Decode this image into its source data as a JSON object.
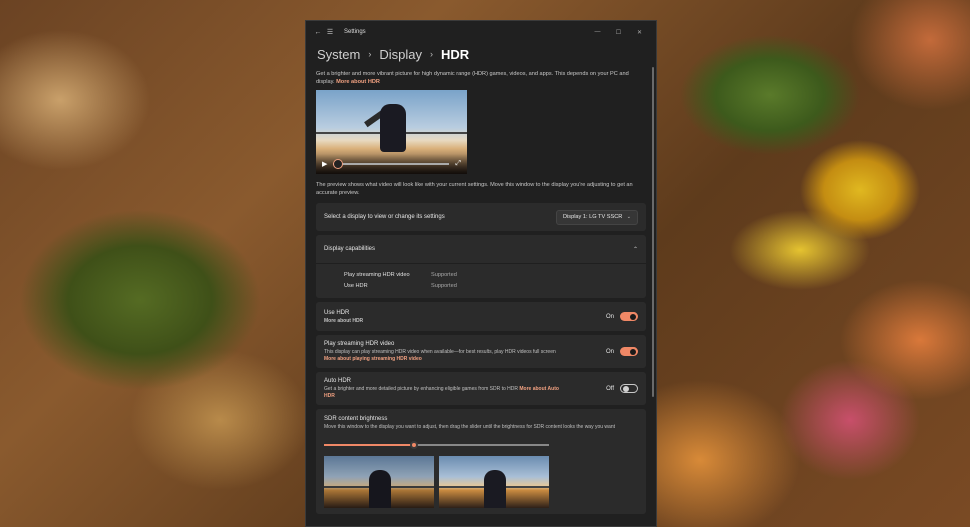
{
  "window": {
    "title": "Settings",
    "controls": {
      "minimize": "—",
      "maximize": "☐",
      "close": "✕"
    }
  },
  "breadcrumb": [
    "System",
    "Display",
    "HDR"
  ],
  "intro": {
    "text": "Get a brighter and more vibrant picture for high dynamic range (HDR) games, videos, and apps. This depends on your PC and display.",
    "link": "More about HDR"
  },
  "preview_player": {
    "progress": 0.0
  },
  "preview_note": "The preview shows what video will look like with your current settings. Move this window to the display you're adjusting to get an accurate preview.",
  "display_select": {
    "label": "Select a display to view or change its settings",
    "selected": "Display 1: LG TV SSCR"
  },
  "capabilities": {
    "header": "Display capabilities",
    "rows": [
      {
        "name": "Play streaming HDR video",
        "value": "Supported"
      },
      {
        "name": "Use HDR",
        "value": "Supported"
      }
    ]
  },
  "use_hdr": {
    "title": "Use HDR",
    "link": "More about HDR",
    "state": "On",
    "on": true
  },
  "streaming_hdr": {
    "title": "Play streaming HDR video",
    "desc": "This display can play streaming HDR video when available—for best results, play HDR videos full screen",
    "link": "More about playing streaming HDR video",
    "state": "On",
    "on": true
  },
  "auto_hdr": {
    "title": "Auto HDR",
    "desc": "Get a brighter and more detailed picture by enhancing eligible games from SDR to HDR",
    "link": "More about Auto HDR",
    "state": "Off",
    "on": false
  },
  "sdr_brightness": {
    "title": "SDR content brightness",
    "desc": "Move this window to the display you want to adjust, then drag the slider until the brightness for SDR content looks the way you want",
    "value": 0.4
  },
  "colors": {
    "accent": "#f08866",
    "window_bg": "#202020",
    "card_bg": "#2b2b2b"
  }
}
